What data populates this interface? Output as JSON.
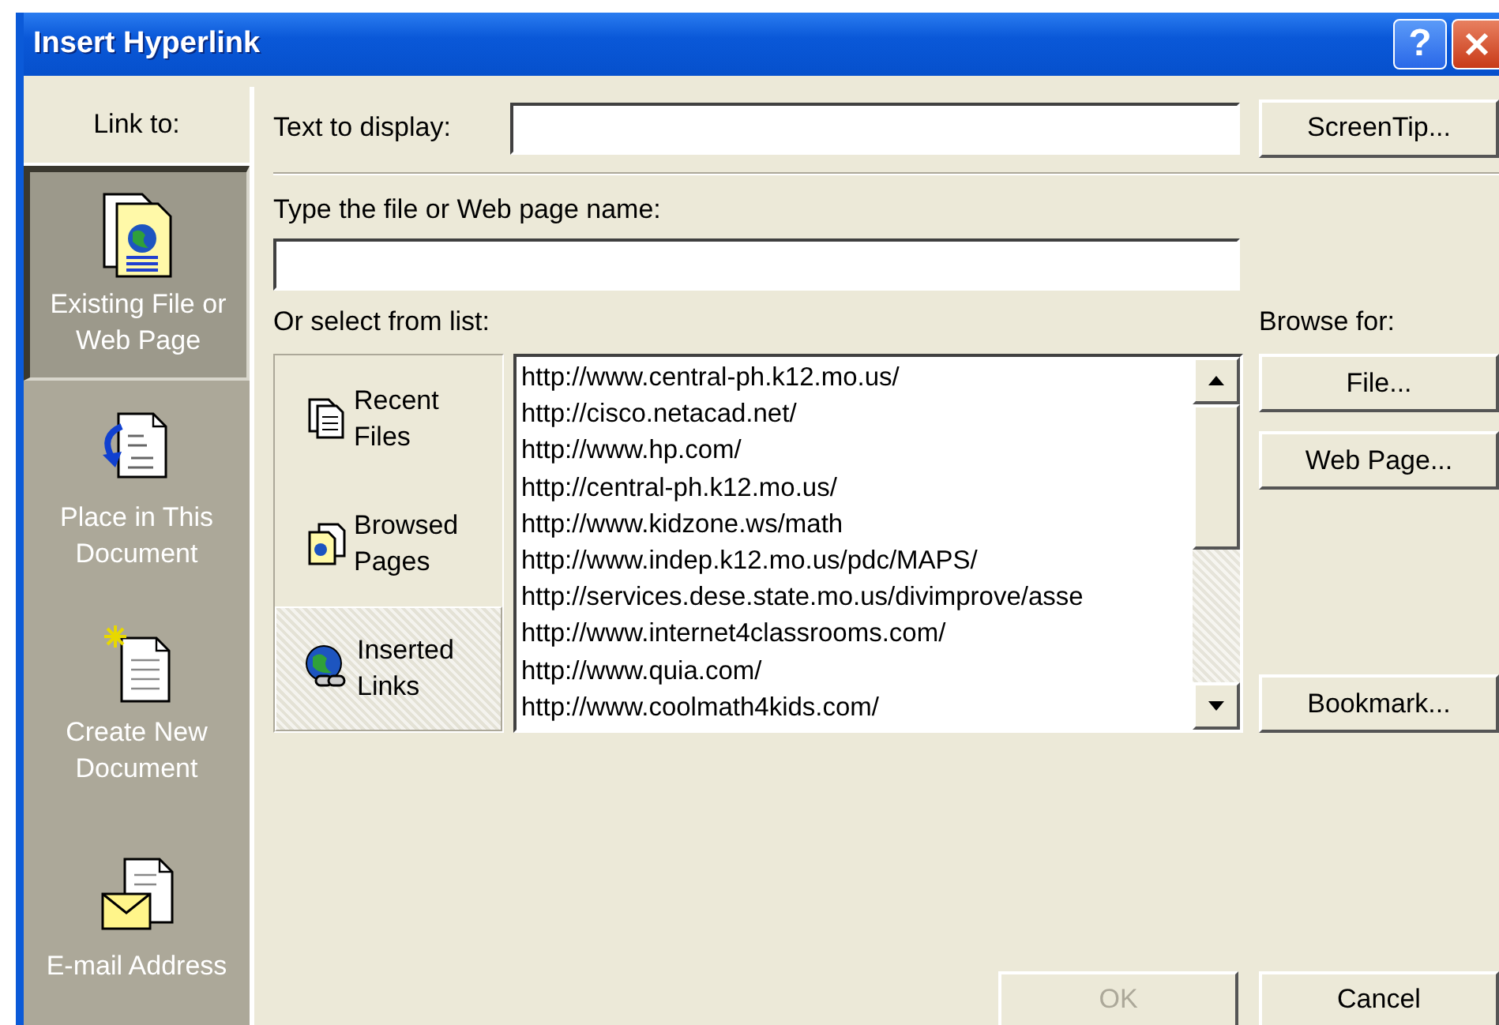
{
  "window": {
    "title": "Insert Hyperlink"
  },
  "title_buttons": [
    {
      "kind": "help",
      "label": "?"
    },
    {
      "kind": "close"
    }
  ],
  "sidebar": {
    "heading": "Link to:",
    "items": [
      {
        "kind": "file",
        "label": "Existing File or Web Page",
        "selected": true
      },
      {
        "kind": "place",
        "label": "Place in This Document",
        "selected": false
      },
      {
        "kind": "new",
        "label": "Create New Document",
        "selected": false
      },
      {
        "kind": "email",
        "label": "E-mail Address",
        "selected": false
      }
    ]
  },
  "text_to_display": {
    "label": "Text to display:"
  },
  "screentip_button": {
    "label": "ScreenTip..."
  },
  "address": {
    "label": "Type the file or Web page name:"
  },
  "list_label": "Or select from list:",
  "browse_label": "Browse for:",
  "list_tabs": [
    {
      "kind": "recent",
      "label": "Recent Files",
      "selected": false
    },
    {
      "kind": "browsed",
      "label": "Browsed Pages",
      "selected": false
    },
    {
      "kind": "inserted",
      "label": "Inserted Links",
      "selected": true
    }
  ],
  "links": [
    "http://www.central-ph.k12.mo.us/",
    "http://cisco.netacad.net/",
    "http://www.hp.com/",
    "http://central-ph.k12.mo.us/",
    "http://www.kidzone.ws/math",
    "http://www.indep.k12.mo.us/pdc/MAPS/",
    "http://services.dese.state.mo.us/divimprove/asse",
    "http://www.internet4classrooms.com/",
    "http://www.quia.com/",
    "http://www.coolmath4kids.com/"
  ],
  "browse_buttons": [
    {
      "label": "File..."
    },
    {
      "label": "Web Page..."
    },
    {
      "label": "Bookmark..."
    }
  ],
  "footer_buttons": [
    {
      "label": "OK",
      "disabled": true
    },
    {
      "label": "Cancel",
      "disabled": false
    }
  ]
}
